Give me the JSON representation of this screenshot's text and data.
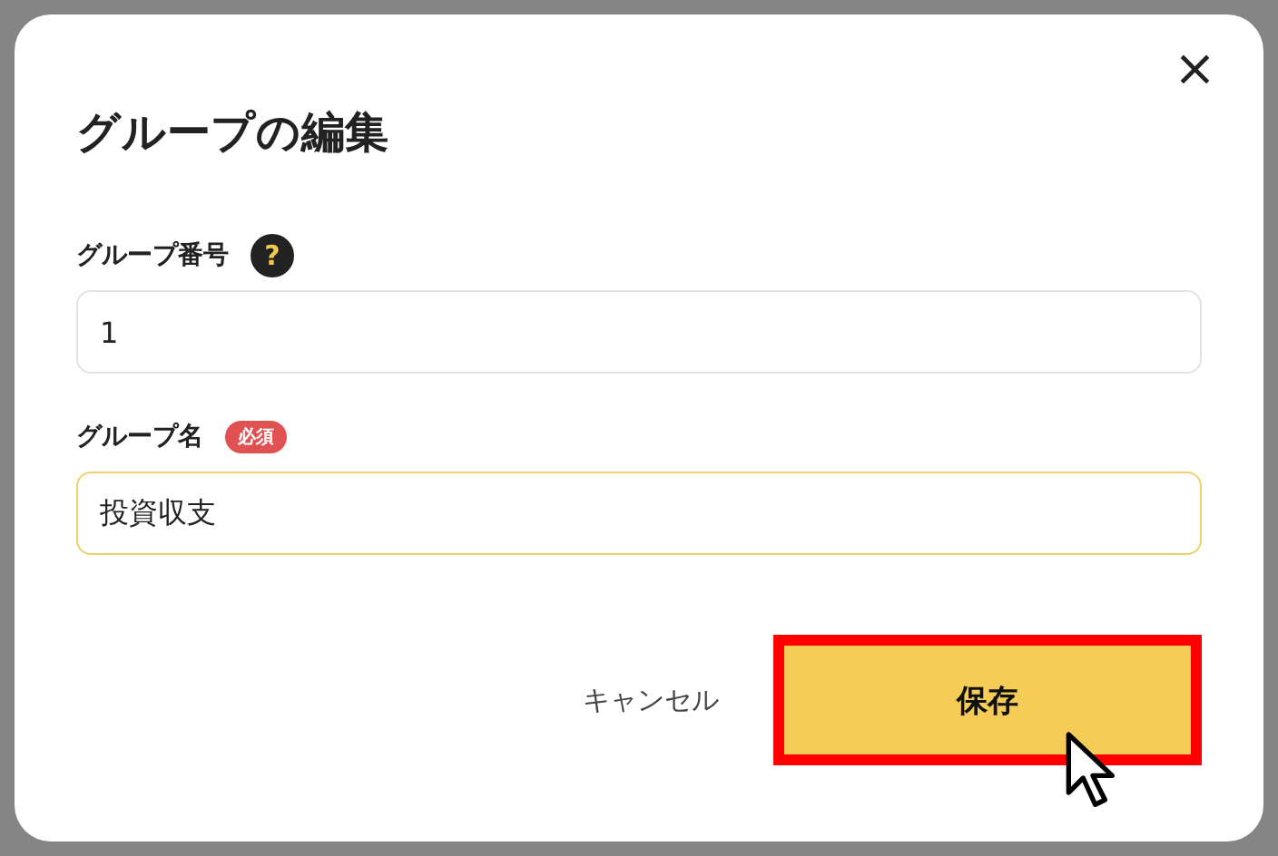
{
  "dialog": {
    "title": "グループの編集",
    "close": "×"
  },
  "fields": [
    {
      "label": "グループ番号",
      "help": "?",
      "value": "1",
      "focused": false
    },
    {
      "label": "グループ名",
      "badge": "必須",
      "value": "投資収支",
      "focused": true
    }
  ],
  "buttons": [
    {
      "kind": "text",
      "label": "キャンセル",
      "highlighted": false
    },
    {
      "kind": "primary",
      "label": "保存",
      "highlighted": true
    }
  ]
}
